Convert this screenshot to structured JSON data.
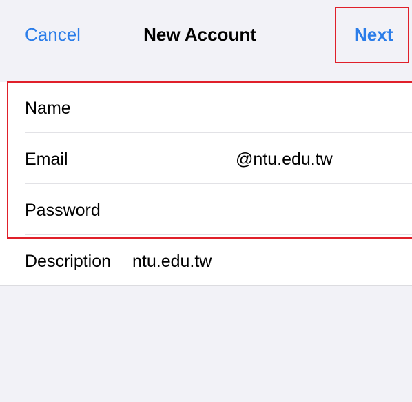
{
  "navbar": {
    "cancel_label": "Cancel",
    "title": "New Account",
    "next_label": "Next"
  },
  "form": {
    "name": {
      "label": "Name",
      "value": ""
    },
    "email": {
      "label": "Email",
      "value": "@ntu.edu.tw"
    },
    "password": {
      "label": "Password",
      "value": ""
    },
    "description": {
      "label": "Description",
      "value": "ntu.edu.tw"
    }
  },
  "colors": {
    "accent": "#2b7de9",
    "highlight": "#e0202a",
    "background": "#f2f2f7",
    "cell": "#ffffff"
  }
}
